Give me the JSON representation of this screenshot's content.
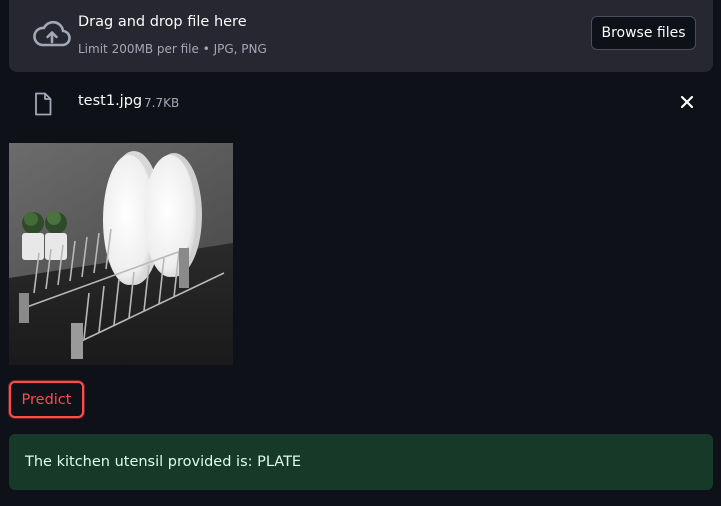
{
  "uploader": {
    "title": "Drag and drop file here",
    "subtitle": "Limit 200MB per file • JPG, PNG",
    "browse_label": "Browse files",
    "icon": "cloud-upload-icon"
  },
  "uploaded_file": {
    "name": "test1.jpg",
    "size": "7.7KB",
    "icon": "file-icon",
    "remove_icon": "close-icon"
  },
  "predict_label": "Predict",
  "result_text": "The kitchen utensil provided is: PLATE",
  "colors": {
    "background": "#0e1117",
    "dropzone": "#262730",
    "accent_red": "#ff4b4b",
    "success_bg": "#173928",
    "success_text": "#dffde9"
  }
}
